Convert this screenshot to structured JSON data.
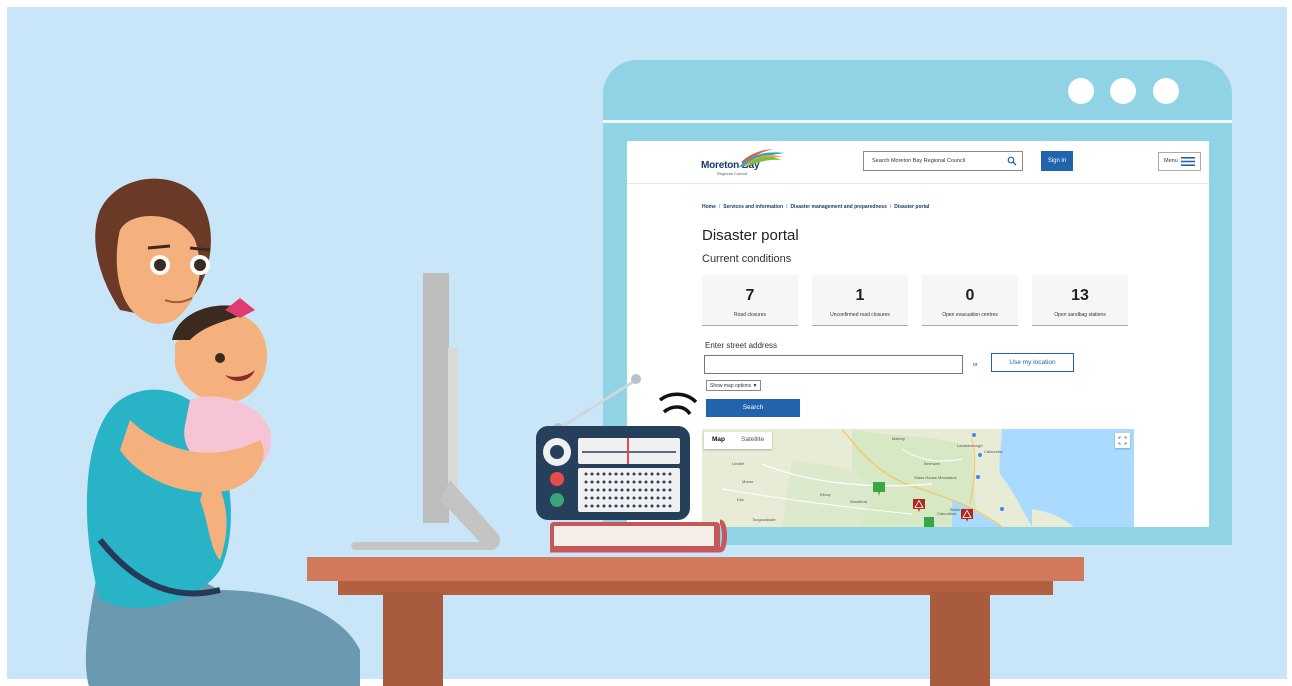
{
  "colors": {
    "background": "#c8e6f7",
    "window_frame": "#8fd3e4",
    "accent_blue": "#2163ad",
    "brand_navy": "#173a6b",
    "table": "#d0795c"
  },
  "header": {
    "logo_text": "Moreton Bay",
    "logo_subtext": "Regional Council",
    "search_placeholder": "Search Moreton Bay Regional Council",
    "search_icon": "search-icon",
    "signin_label": "Sign in",
    "menu_label": "Menu",
    "menu_icon": "hamburger-icon"
  },
  "breadcrumb": {
    "items": [
      "Home",
      "Services and information",
      "Disaster management and preparedness",
      "Disaster portal"
    ],
    "separator": "/"
  },
  "page": {
    "title": "Disaster portal",
    "subtitle": "Current conditions"
  },
  "stats": [
    {
      "value": "7",
      "label": "Road closures"
    },
    {
      "value": "1",
      "label": "Unconfirmed road closures"
    },
    {
      "value": "0",
      "label": "Open evacuation centres"
    },
    {
      "value": "13",
      "label": "Open sandbag stations"
    }
  ],
  "address_form": {
    "label": "Enter street address",
    "input_value": "",
    "or_text": "or",
    "location_button": "Use my location",
    "map_options_label": "Show map options",
    "search_button": "Search"
  },
  "map": {
    "tab_map": "Map",
    "tab_satellite": "Satellite",
    "active_tab": "Map",
    "fullscreen_icon": "fullscreen-icon",
    "place_labels": [
      "Linville",
      "Moore",
      "Kilcoy",
      "Woodford",
      "Beerwah",
      "Caboolture",
      "Bribie Island",
      "Glass House Mountains",
      "Esk",
      "Toogoolawah",
      "Caloundra",
      "Maleny",
      "Landsborough"
    ],
    "markers": [
      {
        "type": "green",
        "icon": "sandbag-marker-icon"
      },
      {
        "type": "warning",
        "icon": "road-closure-warning-icon"
      },
      {
        "type": "warning",
        "icon": "road-closure-warning-icon"
      }
    ]
  }
}
